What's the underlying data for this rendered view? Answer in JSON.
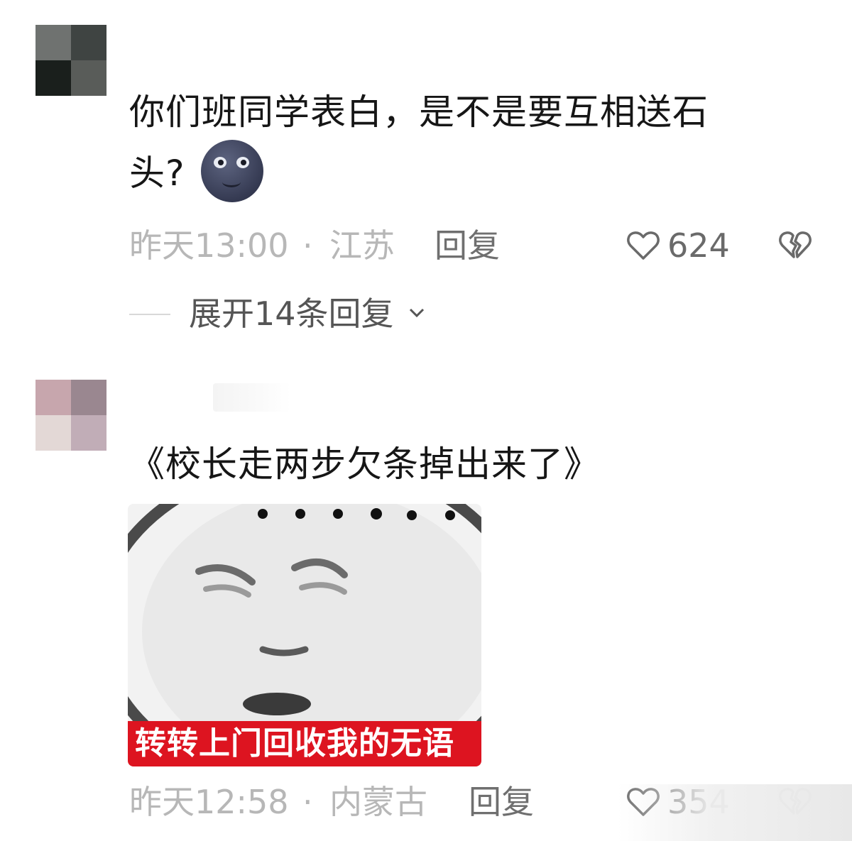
{
  "comments": [
    {
      "avatar_colors": [
        "#6f7270",
        "#3f4442",
        "#1a1f1c",
        "#595c59"
      ],
      "text_line1": "你们班同学表白，是不是要互相送石",
      "text_line2": "头?",
      "emoji": "new-moon-face",
      "time": "昨天13:00",
      "dot": "·",
      "location": "江苏",
      "reply_label": "回复",
      "likes": "624",
      "expand_label": "展开14条回复"
    },
    {
      "avatar_colors": [
        "#c7a6ad",
        "#9a8790",
        "#e3d8d6",
        "#c1adb7"
      ],
      "text_line1": "《校长走两步欠条掉出来了》",
      "meme_caption": "转转上门回收我的无语",
      "time": "昨天12:58",
      "dot": "·",
      "location": "内蒙古",
      "reply_label": "回复",
      "likes": "354"
    }
  ]
}
